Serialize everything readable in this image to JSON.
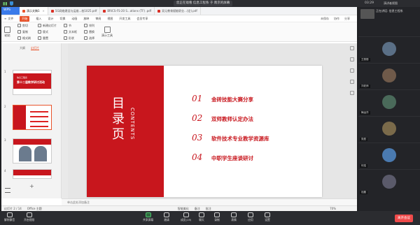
{
  "meeting": {
    "title": "您正在观看 信息工程系 于 南京的屏幕",
    "clock": "03:29",
    "layout_label": "演讲者视图"
  },
  "wps": {
    "logo": "WPS",
    "tabs": [
      {
        "label": "演示文稿1",
        "active": true
      },
      {
        "label": "5G网络建设与运维...校1025.pdf",
        "active": false
      },
      {
        "label": "BRICS-FS-20 S...ations (TF) .pdf",
        "active": false
      },
      {
        "label": "双元教育赋能职业...(定).pdf",
        "active": false
      }
    ],
    "menu": [
      "文件",
      "开始",
      "插入",
      "设计",
      "切换",
      "动画",
      "放映",
      "审阅",
      "视图",
      "开发工具",
      "会员专享"
    ],
    "menu_active": "开始",
    "menu_right": [
      "未保存",
      "协作",
      "分享"
    ],
    "ribbon": {
      "group1": [
        "剪切",
        "复制",
        "格式刷"
      ],
      "big1": "粘贴",
      "group2": [
        "新建幻灯片",
        "版式",
        "重置"
      ],
      "group3": [
        "节",
        "文本框",
        "形状"
      ],
      "group4": [
        "排列",
        "替换",
        "选择"
      ],
      "big2": "演示工具"
    }
  },
  "leftpane": {
    "tabs": [
      "大纲",
      "幻灯片"
    ],
    "thumbs": [
      {
        "num": "1",
        "caption": "信息工程系",
        "title": "第十二届教学研讨活动"
      },
      {
        "num": "2"
      },
      {
        "num": "3"
      },
      {
        "num": "4"
      }
    ],
    "add": "+"
  },
  "slide": {
    "title_chars": [
      "目",
      "录",
      "页"
    ],
    "subtitle": "CONTENTS",
    "items": [
      {
        "num": "01",
        "text": "金砖技能大赛分享"
      },
      {
        "num": "02",
        "text": "双师教师认定办法"
      },
      {
        "num": "03",
        "text": "软件技术专业教学资源库"
      },
      {
        "num": "04",
        "text": "中职学生座谈研讨"
      }
    ]
  },
  "notes": "单击此处添加备注",
  "status": {
    "slide_count": "幻灯片 2 / 14",
    "theme": "Office 主题",
    "smart": "智能美化",
    "notes_btn": "备注",
    "comment": "批注",
    "zoom": "70%"
  },
  "participants": {
    "header": "正在讲话: 信息工程系",
    "people": [
      "王丽丽",
      "刘老师",
      "梅运洋",
      "张庭",
      "何浩",
      "钱晨"
    ]
  },
  "controls": [
    {
      "label": "解除静音",
      "icon": "mic-icon"
    },
    {
      "label": "开启视频",
      "icon": "camera-icon"
    },
    {
      "label": "共享屏幕",
      "icon": "share-icon"
    },
    {
      "label": "邀请",
      "icon": "invite-icon"
    },
    {
      "label": "成员(19)",
      "icon": "members-icon"
    },
    {
      "label": "聊天",
      "icon": "chat-icon"
    },
    {
      "label": "录制",
      "icon": "record-icon"
    },
    {
      "label": "表情",
      "icon": "emoji-icon"
    },
    {
      "label": "应用",
      "icon": "apps-icon"
    },
    {
      "label": "设置",
      "icon": "settings-icon"
    }
  ],
  "leave": "离开会议",
  "colors": {
    "accent": "#c8161d",
    "wps_orange": "#e8542c",
    "leave": "#ef4a4a"
  }
}
